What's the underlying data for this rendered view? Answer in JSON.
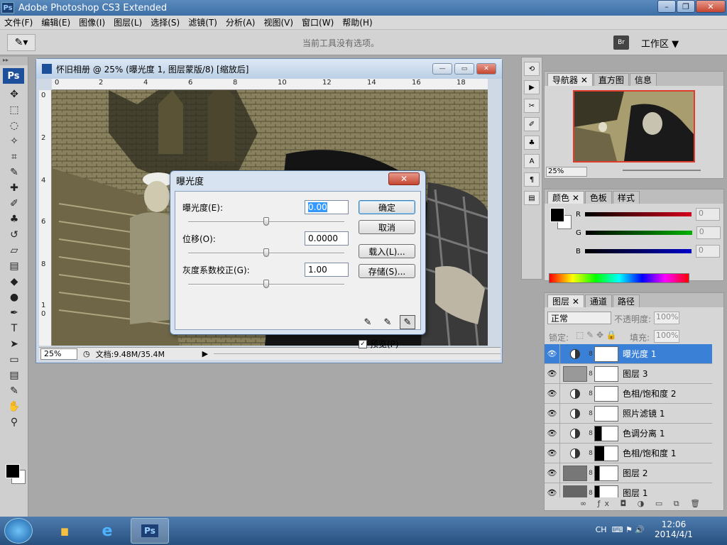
{
  "app": {
    "title": "Adobe Photoshop CS3 Extended",
    "logo": "Ps"
  },
  "menu": [
    "文件(F)",
    "编辑(E)",
    "图像(I)",
    "图层(L)",
    "选择(S)",
    "滤镜(T)",
    "分析(A)",
    "视图(V)",
    "窗口(W)",
    "帮助(H)"
  ],
  "options_bar": {
    "hint": "当前工具没有选项。",
    "workspace": "工作区 ▼",
    "bridge": "Br"
  },
  "toolbox": {
    "logo": "Ps"
  },
  "document": {
    "title": "怀旧相册 @ 25% (曝光度 1, 图层蒙版/8) [缩放后]",
    "ruler_h": [
      "0",
      "2",
      "4",
      "6",
      "8",
      "10",
      "12",
      "14",
      "16",
      "18"
    ],
    "ruler_v": [
      "0",
      "2",
      "4",
      "6",
      "8",
      "1",
      "0"
    ],
    "zoom": "25%",
    "doc_info": "文档:9.48M/35.4M"
  },
  "dialog": {
    "title": "曝光度",
    "exposure_label": "曝光度(E):",
    "exposure_value": "0.00",
    "offset_label": "位移(O):",
    "offset_value": "0.0000",
    "gamma_label": "灰度系数校正(G):",
    "gamma_value": "1.00",
    "ok": "确定",
    "cancel": "取消",
    "load": "载入(L)...",
    "save": "存储(S)...",
    "preview": "预览(P)",
    "preview_checked": true
  },
  "navigator": {
    "tabs": [
      "导航器",
      "直方图",
      "信息"
    ],
    "zoom": "25%"
  },
  "color": {
    "tabs": [
      "颜色",
      "色板",
      "样式"
    ],
    "channels": [
      {
        "label": "R",
        "value": "0",
        "color": "#d4001c"
      },
      {
        "label": "G",
        "value": "0",
        "color": "#00b000"
      },
      {
        "label": "B",
        "value": "0",
        "color": "#0000c8"
      }
    ]
  },
  "layers": {
    "tabs": [
      "图层",
      "通道",
      "路径"
    ],
    "mode": "正常",
    "opacity_label": "不透明度:",
    "opacity": "100%",
    "lock_label": "锁定:",
    "fill_label": "填充:",
    "fill": "100%",
    "items": [
      {
        "name": "曝光度 1",
        "kind": "adj",
        "selected": true
      },
      {
        "name": "图层 3",
        "kind": "img"
      },
      {
        "name": "色相/饱和度 2",
        "kind": "adj"
      },
      {
        "name": "照片滤镜 1",
        "kind": "adj"
      },
      {
        "name": "色调分离 1",
        "kind": "adj"
      },
      {
        "name": "色相/饱和度 1",
        "kind": "adj"
      },
      {
        "name": "图层 2",
        "kind": "img"
      },
      {
        "name": "图层 1",
        "kind": "img"
      }
    ]
  },
  "taskbar": {
    "lang": "CH",
    "time": "12:06",
    "date": "2014/4/1",
    "ps_label": "Ps"
  }
}
